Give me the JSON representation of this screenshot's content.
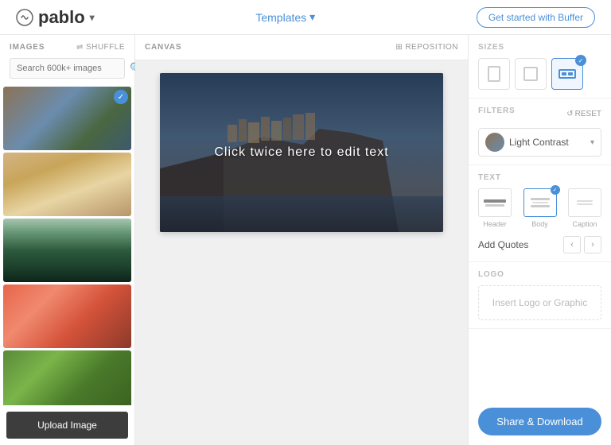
{
  "header": {
    "logo_text": "pablo",
    "templates_label": "Templates",
    "cta_label": "Get started with Buffer"
  },
  "sidebar": {
    "images_label": "IMAGES",
    "shuffle_label": "SHUFFLE",
    "search_placeholder": "Search 600k+ images",
    "upload_label": "Upload Image"
  },
  "canvas": {
    "label": "CANVAS",
    "reposition_label": "REPOSITION",
    "edit_text": "Click twice here to edit text"
  },
  "right_panel": {
    "sizes_label": "SIZES",
    "filters_label": "FILTERS",
    "reset_label": "RESET",
    "filter_name": "Light Contrast",
    "text_label": "TEXT",
    "text_header": "Header",
    "text_body": "Body",
    "text_caption": "Caption",
    "add_quotes_label": "Add Quotes",
    "logo_label": "LOGO",
    "logo_insert": "Insert Logo or Graphic",
    "share_label": "Share & Download"
  }
}
